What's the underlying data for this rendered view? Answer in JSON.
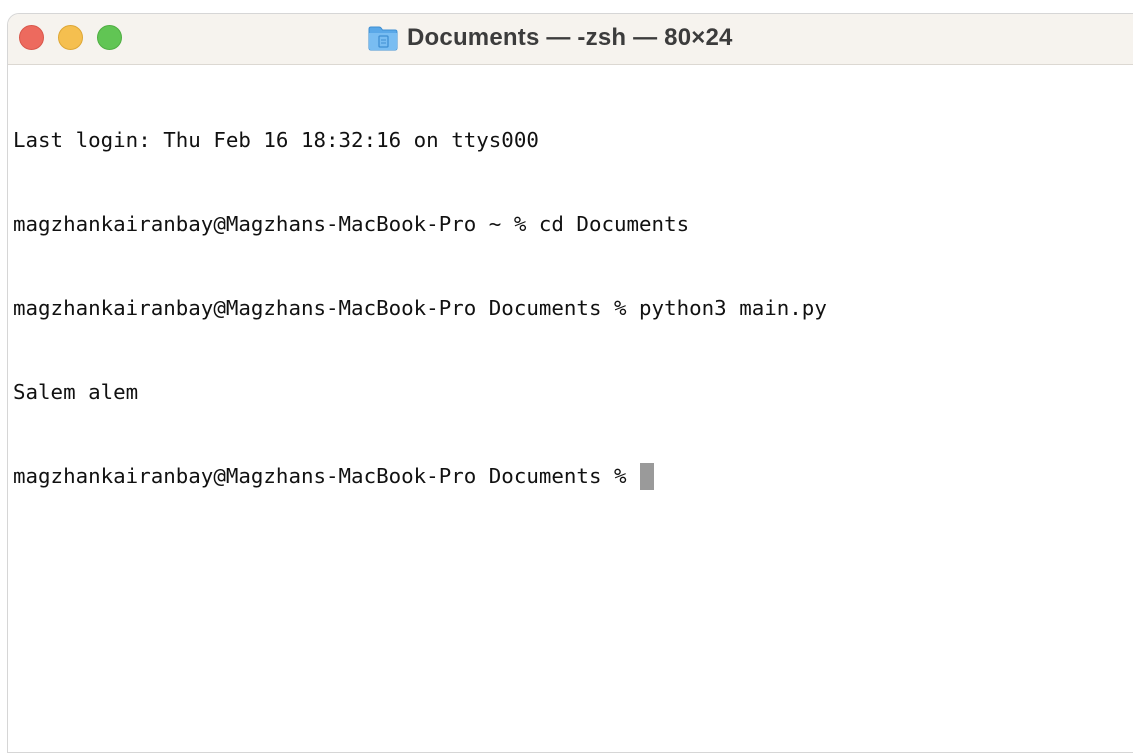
{
  "window": {
    "title": "Documents — -zsh — 80×24",
    "folder_icon": "folder-icon",
    "controls": {
      "close_color": "#ed6a5e",
      "minimize_color": "#f5bf4f",
      "zoom_color": "#61c554"
    }
  },
  "terminal": {
    "lines": [
      "Last login: Thu Feb 16 18:32:16 on ttys000",
      "magzhankairanbay@Magzhans-MacBook-Pro ~ % cd Documents",
      "magzhankairanbay@Magzhans-MacBook-Pro Documents % python3 main.py",
      "Salem alem"
    ],
    "prompt": "magzhankairanbay@Magzhans-MacBook-Pro Documents %",
    "cursor_color": "#9a9a9a"
  }
}
